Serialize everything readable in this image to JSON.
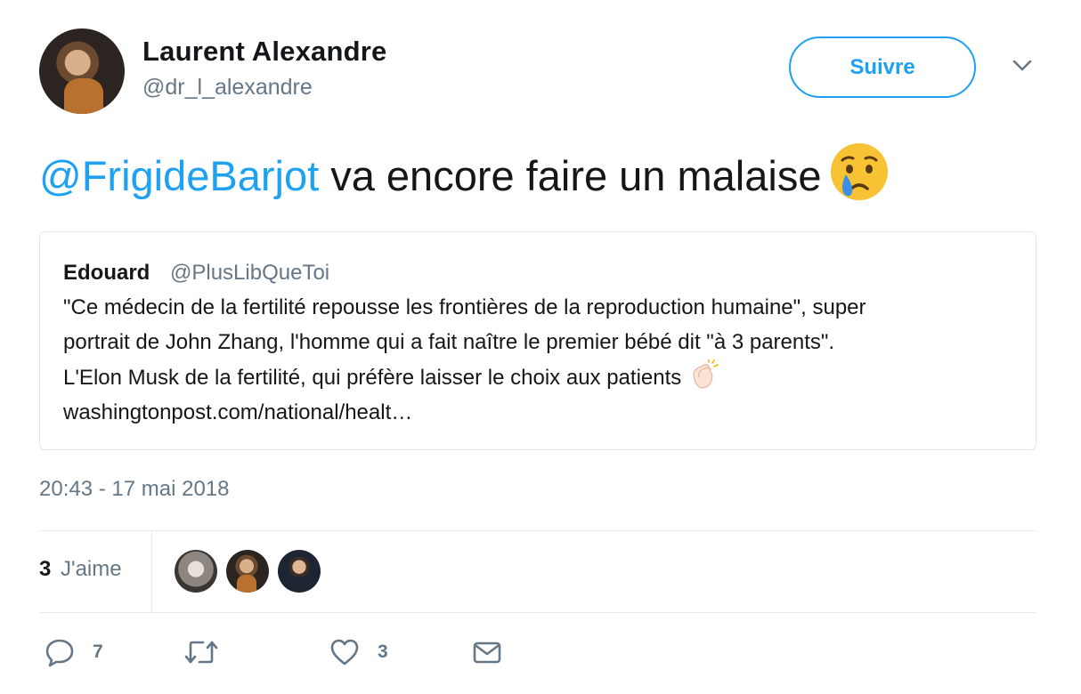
{
  "author": {
    "name": "Laurent Alexandre",
    "handle": "@dr_l_alexandre"
  },
  "follow_button": {
    "label": "Suivre"
  },
  "tweet": {
    "mention": "@FrigideBarjot",
    "text": " va encore faire un malaise",
    "emoji": "crying-face"
  },
  "quote": {
    "name": "Edouard",
    "handle": "@PlusLibQueToi",
    "lines": [
      "\"Ce médecin de la fertilité repousse les frontières de la reproduction humaine\", super",
      "portrait de John Zhang, l'homme qui a fait naître le premier bébé dit \"à 3 parents\".",
      "L'Elon Musk de la fertilité, qui préfère laisser le choix aux patients",
      "washingtonpost.com/national/healt…"
    ],
    "emoji": "clapping-hands"
  },
  "timestamp": "20:43 - 17 mai 2018",
  "likes": {
    "count": "3",
    "label": "J'aime"
  },
  "actions": {
    "reply_count": "7",
    "retweet_count": "",
    "like_count": "3"
  },
  "colors": {
    "accent": "#1da1f2",
    "secondary_text": "#657786",
    "border": "#e1e8ed"
  }
}
